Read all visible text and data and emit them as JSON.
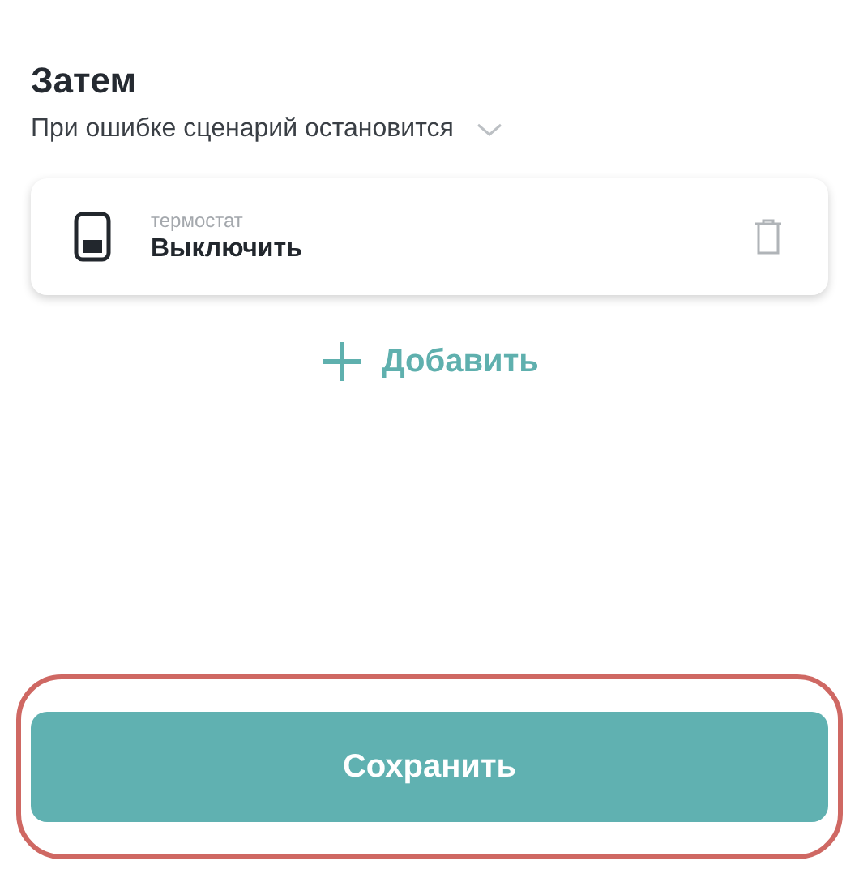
{
  "section": {
    "title": "Затем",
    "error_policy": "При ошибке сценарий остановится"
  },
  "actions": [
    {
      "device": "термостат",
      "action": "Выключить"
    }
  ],
  "add_button": {
    "label": "Добавить"
  },
  "save_button": {
    "label": "Сохранить",
    "highlighted": true
  }
}
